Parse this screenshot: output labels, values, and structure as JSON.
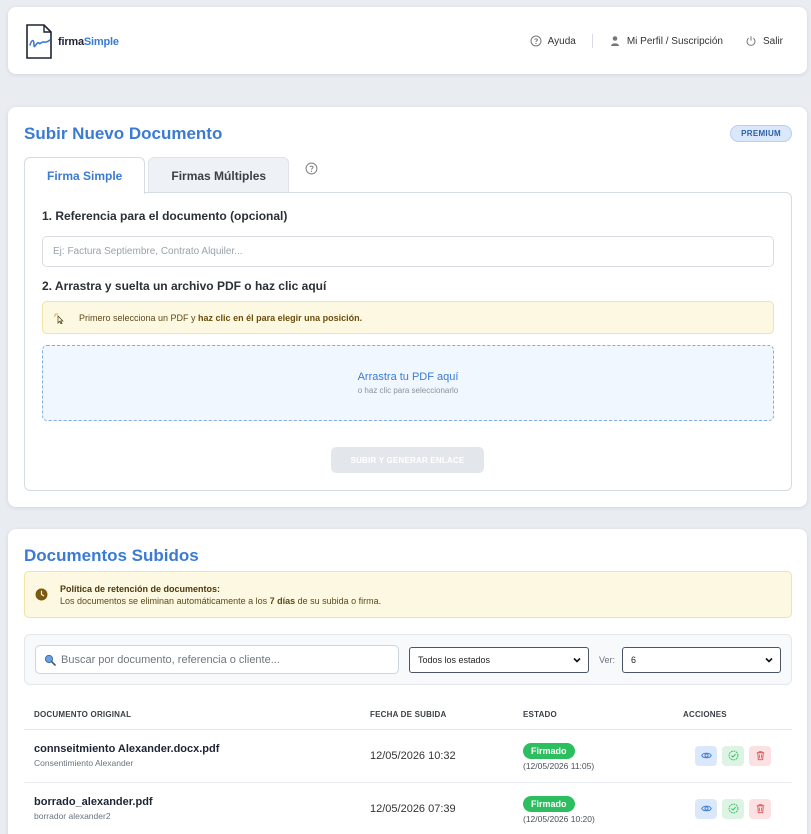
{
  "header": {
    "logo_prefix": "firma",
    "logo_suffix": "Simple",
    "nav": {
      "help": "Ayuda",
      "profile": "Mi Perfil / Suscripción",
      "logout": "Salir"
    }
  },
  "upload": {
    "title": "Subir Nuevo Documento",
    "badge": "PREMIUM",
    "tabs": [
      {
        "label": "Firma Simple",
        "active": true
      },
      {
        "label": "Firmas Múltiples",
        "active": false
      }
    ],
    "step1_label": "1. Referencia para el documento (opcional)",
    "reference_placeholder": "Ej: Factura Septiembre, Contrato Alquiler...",
    "reference_value": "",
    "step2_label": "2. Arrastra y suelta un archivo PDF o haz clic aquí",
    "hint_prefix": "Primero selecciona un PDF y ",
    "hint_bold": "haz clic en él para elegir una posición.",
    "dropzone_main": "Arrastra tu PDF aquí",
    "dropzone_sub": "o haz clic para seleccionarlo",
    "submit_label": "SUBIR Y GENERAR ENLACE"
  },
  "docs": {
    "title": "Documentos Subidos",
    "policy_title": "Política de retención de documentos:",
    "policy_prefix": "Los documentos se eliminan automáticamente a los ",
    "policy_bold": "7 días",
    "policy_suffix": " de su subida o firma.",
    "search_placeholder": "Buscar por documento, referencia o cliente...",
    "status_filter": "Todos los estados",
    "ver_label": "Ver:",
    "per_page": "6",
    "columns": [
      "DOCUMENTO ORIGINAL",
      "FECHA DE SUBIDA",
      "ESTADO",
      "ACCIONES"
    ],
    "rows": [
      {
        "name": "connseitmiento Alexander.docx.pdf",
        "reference": "Consentimiento Alexander",
        "uploaded": "12/05/2026 10:32",
        "status": "Firmado",
        "status_date": "(12/05/2026 11:05)"
      },
      {
        "name": "borrado_alexander.pdf",
        "reference": "borrador alexander2",
        "uploaded": "12/05/2026 07:39",
        "status": "Firmado",
        "status_date": "(12/05/2026 10:20)"
      }
    ]
  },
  "colors": {
    "accent": "#3b7bd3",
    "success": "#2dbf5f",
    "warning_bg": "#fdf8e1",
    "danger": "#e05555"
  }
}
